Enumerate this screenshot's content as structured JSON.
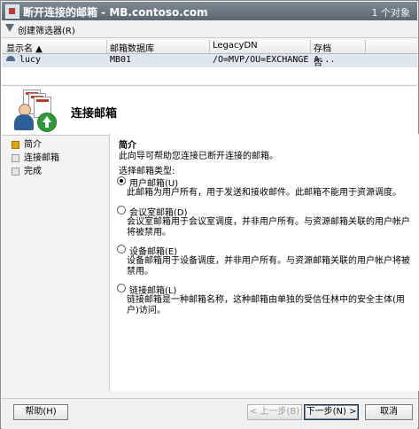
{
  "console": {
    "title": "断开连接的邮箱 - MB.contoso.com",
    "object_count": "1 个对象",
    "toolbar": {
      "create_filter": "创建筛选器(R)"
    },
    "columns": [
      "显示名 ▲",
      "邮箱数据库",
      "LegacyDN",
      "存档"
    ],
    "rows": [
      {
        "name": "lucy",
        "database": "MB01",
        "legacy_dn": "/O=MVP/OU=EXCHANGE A...",
        "archive": "否"
      }
    ]
  },
  "wizard": {
    "title": "连接邮箱",
    "steps": [
      {
        "label": "简介",
        "active": true
      },
      {
        "label": "连接邮箱",
        "active": false
      },
      {
        "label": "完成",
        "active": false
      }
    ],
    "page": {
      "heading": "简介",
      "description": "此向导可帮助您连接已断开连接的邮箱。",
      "prompt": "选择邮箱类型:",
      "options": [
        {
          "label": "用户邮箱(U)",
          "selected": true,
          "description": "此邮箱为用户所有，用于发送和接收邮件。此邮箱不能用于资源调度。"
        },
        {
          "label": "会议室邮箱(D)",
          "selected": false,
          "description": "会议室邮箱用于会议室调度，并非用户所有。与资源邮箱关联的用户帐户将被禁用。"
        },
        {
          "label": "设备邮箱(E)",
          "selected": false,
          "description": "设备邮箱用于设备调度，并非用户所有。与资源邮箱关联的用户帐户将被禁用。"
        },
        {
          "label": "链接邮箱(L)",
          "selected": false,
          "description": "链接邮箱是一种邮箱名称，这种邮箱由单独的受信任林中的安全主体(用户)访问。"
        }
      ]
    },
    "buttons": {
      "help": "帮助(H)",
      "back": "< 上一步(B)",
      "next": "下一步(N) >",
      "cancel": "取消"
    }
  }
}
